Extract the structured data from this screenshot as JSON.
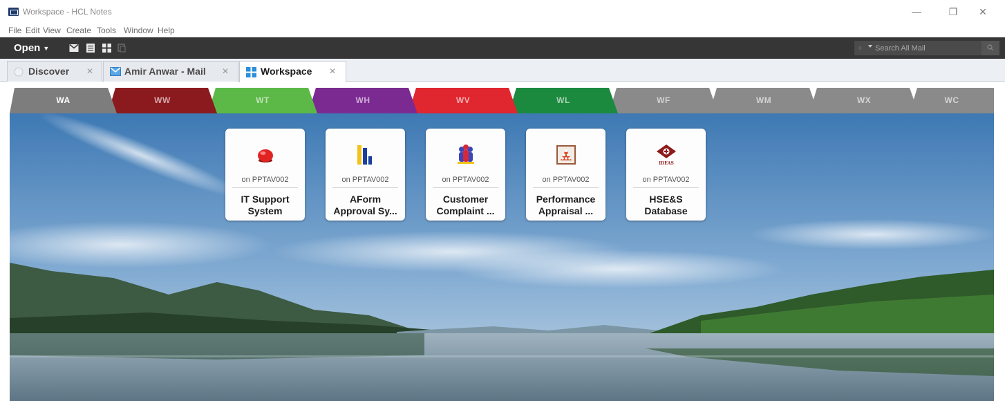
{
  "window": {
    "title": "Workspace - HCL Notes",
    "controls": {
      "minimize": "—",
      "maximize": "❐",
      "close": "✕"
    },
    "icon": "notes-app-icon"
  },
  "menu": [
    "File",
    "Edit",
    "View",
    "Create",
    "Tools",
    "Window",
    "Help"
  ],
  "toolbar": {
    "open_label": "Open",
    "icons": [
      "mail-icon",
      "calendar-icon",
      "workspace-icon",
      "replicator-icon"
    ],
    "search_placeholder": "Search All Mail"
  },
  "doc_tabs": [
    {
      "label": "Discover",
      "icon": "discover-icon",
      "close": "✕",
      "active": false
    },
    {
      "label": "Amir Anwar - Mail",
      "icon": "mail-icon",
      "close": "✕",
      "active": false
    },
    {
      "label": "Workspace",
      "icon": "workspace-icon",
      "close": "✕",
      "active": true
    }
  ],
  "workspace_tabs": [
    {
      "label": "WA",
      "color": "#7d7d7d",
      "active": true
    },
    {
      "label": "WW",
      "color": "#8b1a1e"
    },
    {
      "label": "WT",
      "color": "#5cb947"
    },
    {
      "label": "WH",
      "color": "#7b2a92"
    },
    {
      "label": "WV",
      "color": "#e0262e"
    },
    {
      "label": "WL",
      "color": "#1c8a3e"
    },
    {
      "label": "WF",
      "color": "#8a8a8a"
    },
    {
      "label": "WM",
      "color": "#8a8a8a"
    },
    {
      "label": "WX",
      "color": "#8a8a8a"
    },
    {
      "label": "WC",
      "color": "#8a8a8a"
    }
  ],
  "tiles": [
    {
      "server": "on PPTAV002",
      "title": "IT Support\nSystem",
      "icon": "red-button-icon"
    },
    {
      "server": "on PPTAV002",
      "title": "AForm\nApproval Sy...",
      "icon": "bar-chart-icon"
    },
    {
      "server": "on PPTAV002",
      "title": "Customer\nComplaint ...",
      "icon": "people-group-icon"
    },
    {
      "server": "on PPTAV002",
      "title": "Performance\nAppraisal ...",
      "icon": "appraisal-pyramid-icon"
    },
    {
      "server": "on PPTAV002",
      "title": "HSE&S\nDatabase",
      "icon": "ideas-logo-icon",
      "icon_text": "IDEAS"
    }
  ],
  "colors": {
    "toolbar": "#363636",
    "tab_strip": "#eceff3"
  }
}
